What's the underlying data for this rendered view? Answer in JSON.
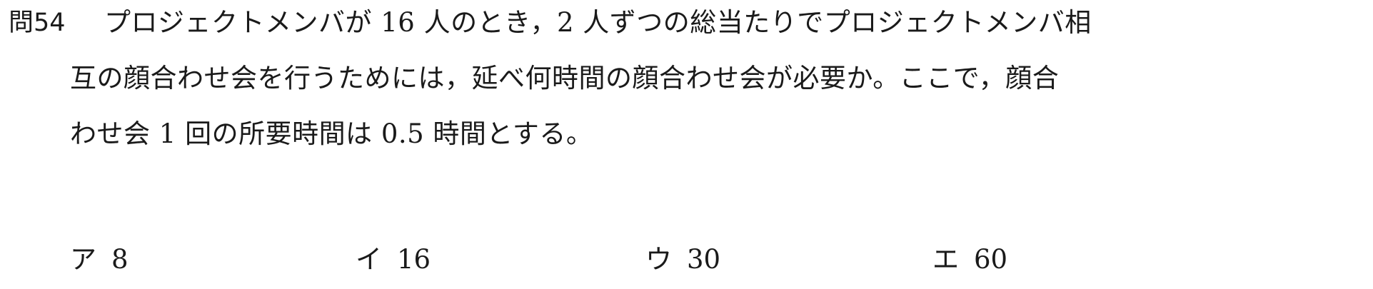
{
  "question": {
    "number": "問54",
    "lines": [
      "プロジェクトメンバが 16 人のとき，2 人ずつの総当たりでプロジェクトメンバ相",
      "互の顔合わせ会を行うためには，延べ何時間の顔合わせ会が必要か。ここで，顔合",
      "わせ会 1 回の所要時間は 0.5 時間とする。"
    ]
  },
  "choices": [
    {
      "label": "ア",
      "value": "8"
    },
    {
      "label": "イ",
      "value": "16"
    },
    {
      "label": "ウ",
      "value": "30"
    },
    {
      "label": "エ",
      "value": "60"
    }
  ]
}
